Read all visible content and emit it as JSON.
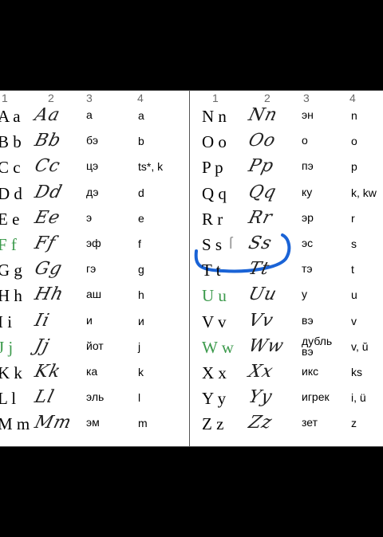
{
  "headers": [
    "1",
    "2",
    "3",
    "4"
  ],
  "left_rows": [
    {
      "print": "A a",
      "script": "Aa",
      "name": "а",
      "sound": "a",
      "green": false
    },
    {
      "print": "B b",
      "script": "Bb",
      "name": "бэ",
      "sound": "b",
      "green": false
    },
    {
      "print": "C c",
      "script": "Cc",
      "name": "цэ",
      "sound": "ts*, k",
      "green": false
    },
    {
      "print": "D d",
      "script": "Dd",
      "name": "дэ",
      "sound": "d",
      "green": false
    },
    {
      "print": "E e",
      "script": "Ee",
      "name": "э",
      "sound": "e",
      "green": false
    },
    {
      "print": "F f",
      "script": "Ff",
      "name": "эф",
      "sound": "f",
      "green": true
    },
    {
      "print": "G g",
      "script": "Gg",
      "name": "гэ",
      "sound": "g",
      "green": false
    },
    {
      "print": "H h",
      "script": "Hh",
      "name": "аш",
      "sound": "h",
      "green": false
    },
    {
      "print": "I i",
      "script": "Ii",
      "name": "и",
      "sound": "и",
      "green": false
    },
    {
      "print": "J j",
      "script": "Jj",
      "name": "йот",
      "sound": "j",
      "green": true
    },
    {
      "print": "K k",
      "script": "Kk",
      "name": "ка",
      "sound": "k",
      "green": false
    },
    {
      "print": "L l",
      "script": "Ll",
      "name": "эль",
      "sound": "l",
      "green": false
    },
    {
      "print": "M m",
      "script": "Mm",
      "name": "эм",
      "sound": "m",
      "green": false
    }
  ],
  "right_rows": [
    {
      "print": "N n",
      "script": "Nn",
      "name": "эн",
      "sound": "n",
      "green": false
    },
    {
      "print": "O o",
      "script": "Oo",
      "name": "о",
      "sound": "o",
      "green": false
    },
    {
      "print": "P p",
      "script": "Pp",
      "name": "пэ",
      "sound": "p",
      "green": false
    },
    {
      "print": "Q q",
      "script": "Qq",
      "name": "ку",
      "sound": "k, kw",
      "green": false
    },
    {
      "print": "R r",
      "script": "Rr",
      "name": "эр",
      "sound": "r",
      "green": false
    },
    {
      "print": "S s",
      "script": "Ss",
      "name": "эс",
      "sound": "s",
      "green": false,
      "extra": "ſ"
    },
    {
      "print": "T t",
      "script": "Tt",
      "name": "тэ",
      "sound": "t",
      "green": false
    },
    {
      "print": "U u",
      "script": "Uu",
      "name": "у",
      "sound": "u",
      "green": true
    },
    {
      "print": "V v",
      "script": "Vv",
      "name": "вэ",
      "sound": "v",
      "green": false
    },
    {
      "print": "W w",
      "script": "Ww",
      "name": "дубль вэ",
      "sound": "v, ŭ",
      "green": true
    },
    {
      "print": "X x",
      "script": "Xx",
      "name": "икс",
      "sound": "ks",
      "green": false
    },
    {
      "print": "Y y",
      "script": "Yy",
      "name": "игрек",
      "sound": "i, ü",
      "green": false
    },
    {
      "print": "Z z",
      "script": "Zz",
      "name": "зет",
      "sound": "z",
      "green": false
    }
  ],
  "colors": {
    "green": "#3c9a4c",
    "highlight": "#1a63d6",
    "background": "#000000",
    "sheet": "#ffffff"
  }
}
